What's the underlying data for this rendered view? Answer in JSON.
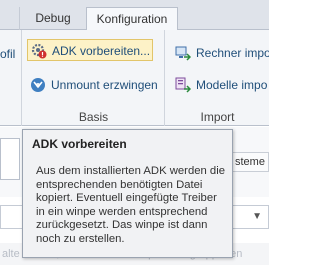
{
  "tabs": [
    {
      "label": ""
    },
    {
      "label": "Debug"
    },
    {
      "label": "Konfiguration"
    }
  ],
  "ribbon": {
    "left_group": {
      "partial_text": "ofil"
    },
    "basis_group": {
      "label": "Basis",
      "adk_button": "ADK vorbereiten...",
      "unmount_button": "Unmount erzwingen"
    },
    "import_group": {
      "label": "Import",
      "rechner_button": "Rechner impo",
      "modelle_button": "Modelle impo"
    }
  },
  "lower": {
    "systeme_tab": "steme",
    "group_hint": "alte hierher, um nach dieser Spalte zu gruppieren"
  },
  "tooltip": {
    "title": "ADK vorbereiten",
    "body": "Aus dem installierten ADK werden die entsprechenden benötigten Datei kopiert. Eventuell eingefügte Treiber in ein winpe werden entsprechend zurückgesetzt. Das winpe ist dann noch zu erstellen."
  },
  "colors": {
    "accent_text": "#1f4e79",
    "highlight_bg": "#fdf2c7",
    "tooltip_bg": "#f1f2f4"
  },
  "icons": {
    "adk": "gear-warning-icon",
    "unmount": "disc-down-icon",
    "rechner_import": "computer-import-icon",
    "modelle_import": "models-import-icon"
  }
}
